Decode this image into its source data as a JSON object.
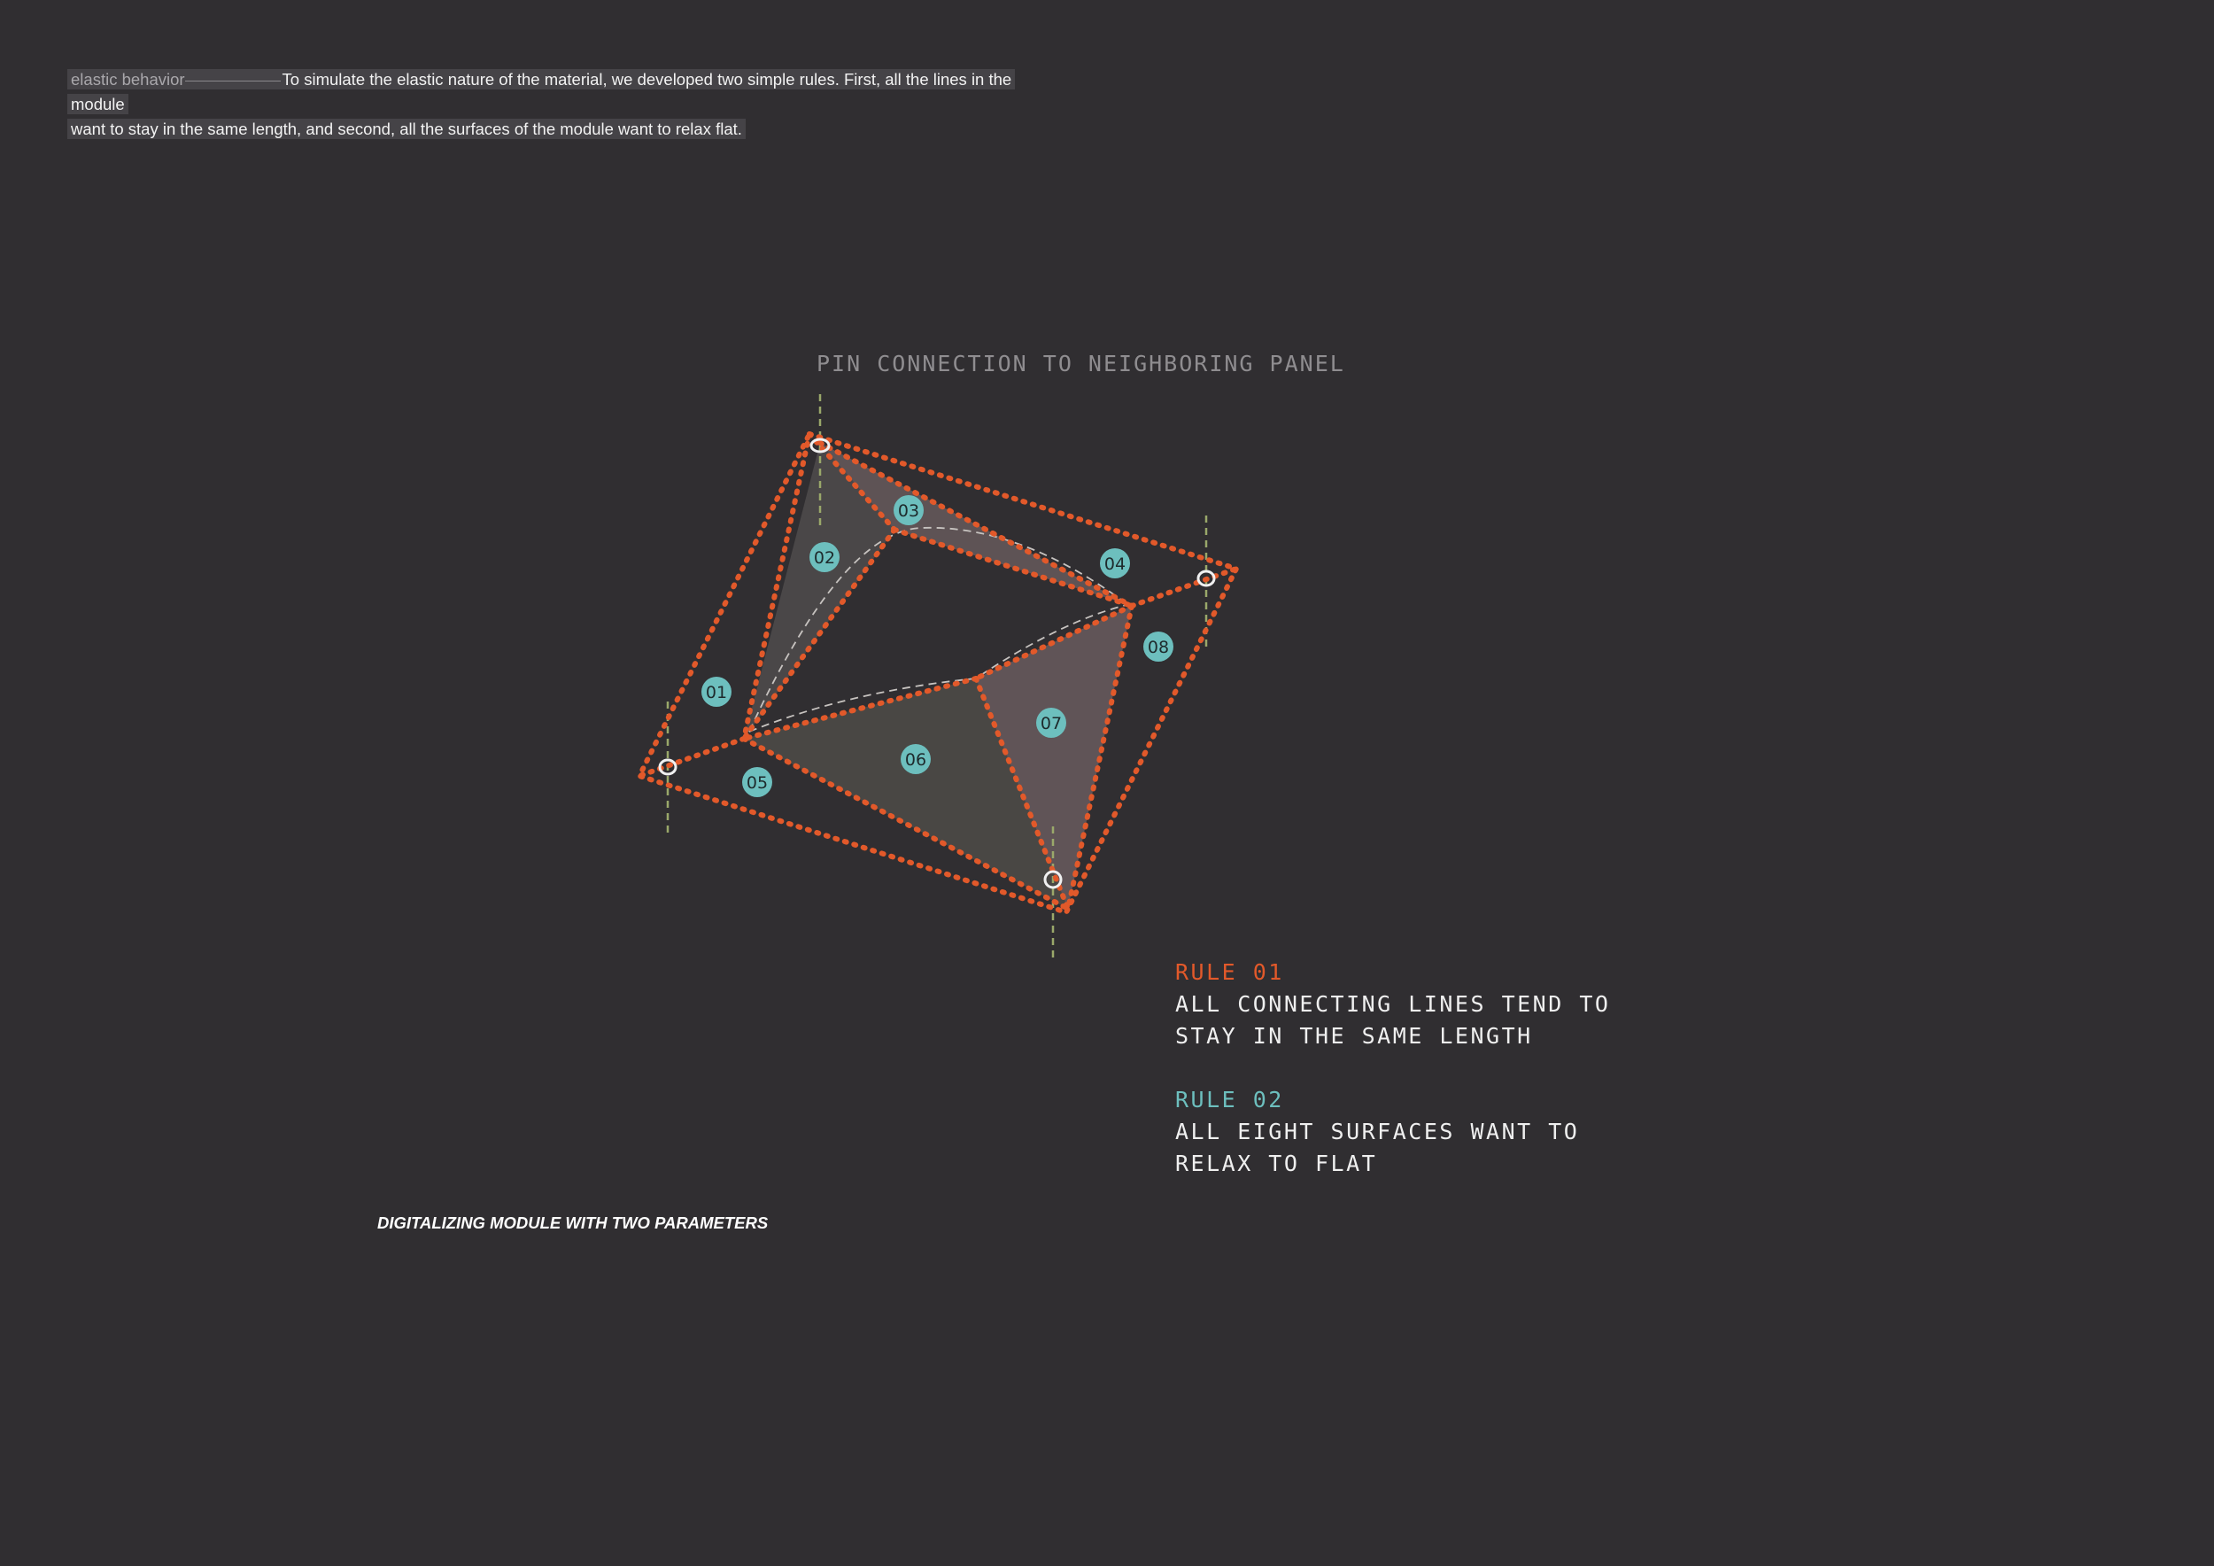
{
  "intro": {
    "keyword": "elastic behavior",
    "line1": "To simulate the elastic nature of the material, we developed two simple rules. First, all the lines in the module",
    "line2": "want to stay in the same length, and second, all the surfaces of the module want to relax flat."
  },
  "pin_label": "PIN CONNECTION TO NEIGHBORING PANEL",
  "rules": [
    {
      "title": "RULE 01",
      "text": "ALL CONNECTING LINES TEND TO\nSTAY IN THE SAME LENGTH",
      "color": "#e2592a"
    },
    {
      "title": "RULE 02",
      "text": "ALL EIGHT SURFACES WANT TO\nRELAX TO FLAT",
      "color": "#6dbfbe"
    }
  ],
  "caption": "DIGITALIZING MODULE WITH TWO PARAMETERS",
  "surface_labels": [
    "01",
    "02",
    "03",
    "04",
    "05",
    "06",
    "07",
    "08"
  ],
  "colors": {
    "background": "#302e31",
    "line": "#e2592a",
    "badge": "#6dbfbe",
    "surface": "#4f4b4c",
    "surface_light": "#66595c",
    "pin_guide": "#9aa86a"
  }
}
